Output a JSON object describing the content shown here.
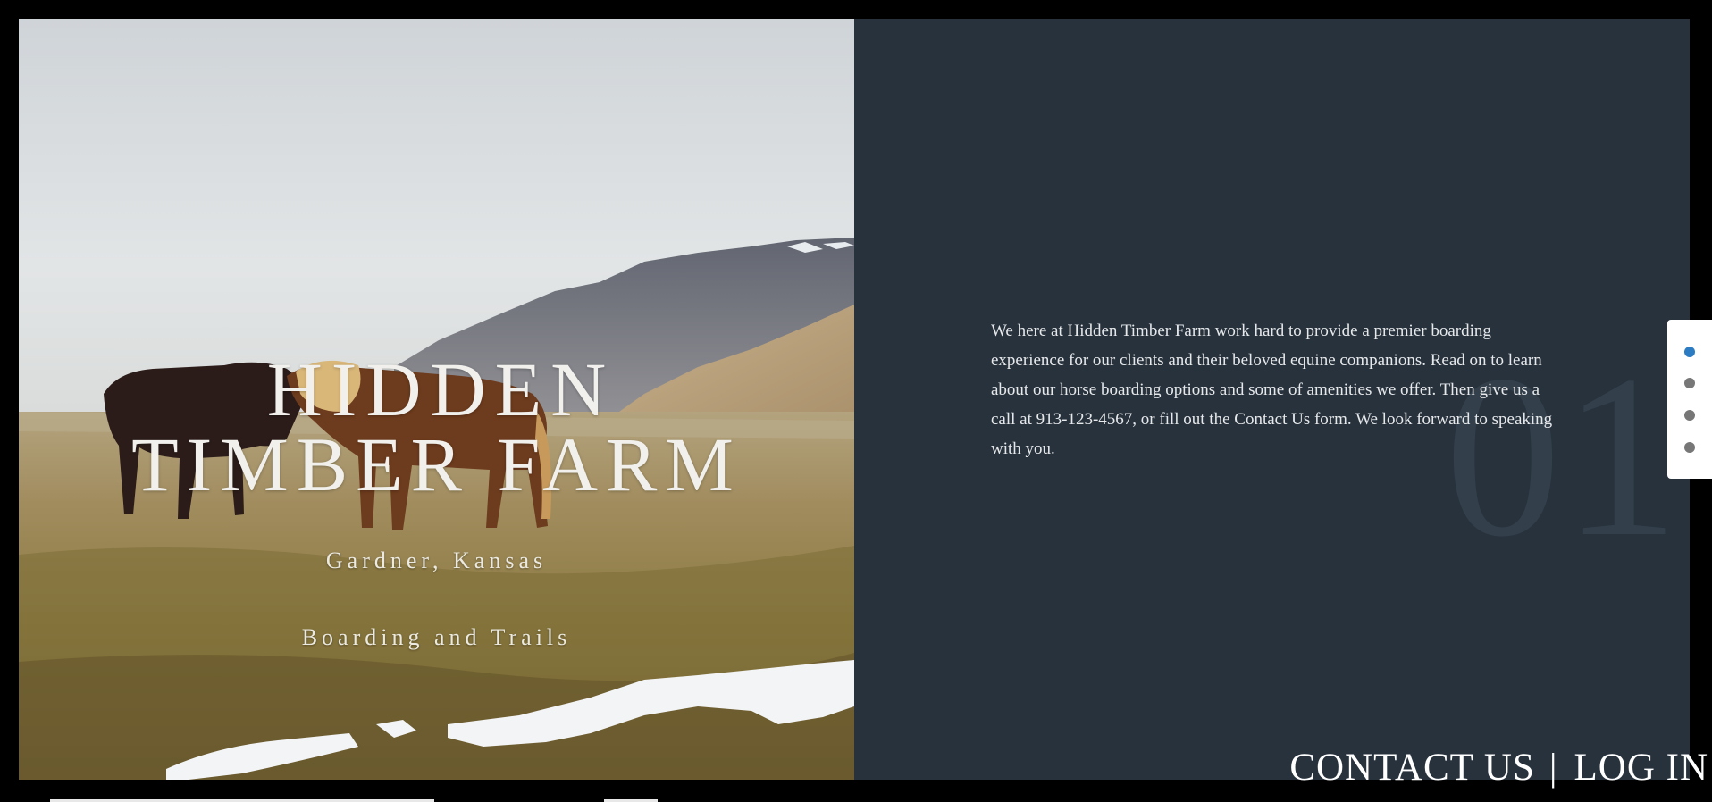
{
  "hero": {
    "title_line1": "HIDDEN",
    "title_line2": "TIMBER FARM",
    "location": "Gardner, Kansas",
    "services": "Boarding and Trails"
  },
  "info": {
    "slide_number": "01",
    "intro_text": "We here at Hidden Timber Farm work hard to provide a premier boarding experience for our clients and their beloved equine companions. Read on to learn about our horse boarding options and some of amenities we offer. Then give us a call at 913-123-4567, or fill out the Contact Us form. We look forward to speaking with you."
  },
  "slider": {
    "slide_count": 4,
    "active_index": 0
  },
  "nav": {
    "contact_label": "CONTACT US",
    "separator": "|",
    "login_label": "LOG IN"
  },
  "colors": {
    "panel_background": "#27323d",
    "active_dot": "#2c7cc3",
    "inactive_dot": "#777777"
  }
}
